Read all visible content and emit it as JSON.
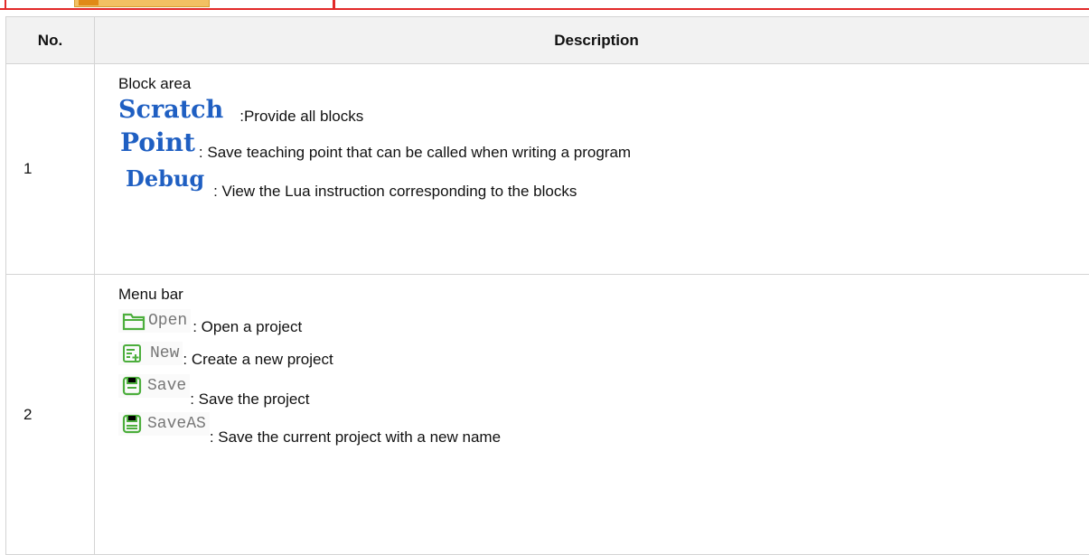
{
  "table": {
    "headers": [
      "No.",
      "Description"
    ],
    "rows": [
      {
        "no": "1",
        "title": "Block area",
        "items": [
          {
            "icon": "Scratch",
            "sep": ":",
            "text": "Provide all blocks"
          },
          {
            "icon": "Point",
            "sep": ": ",
            "text": "Save teaching point that can be called when writing a program"
          },
          {
            "icon": "Debug",
            "sep": ": ",
            "text": "View the Lua instruction corresponding to the blocks"
          }
        ]
      },
      {
        "no": "2",
        "title": "Menu bar",
        "items": [
          {
            "icon": "Open",
            "icon_name": "folder-icon",
            "sep": ": ",
            "text": "Open a project"
          },
          {
            "icon": "New",
            "icon_name": "new-file-icon",
            "sep": ": ",
            "text": "Create a new project"
          },
          {
            "icon": "Save",
            "icon_name": "save-icon",
            "sep": ": ",
            "text": "Save the project"
          },
          {
            "icon": "SaveAS",
            "icon_name": "save-as-icon",
            "sep": ": ",
            "text": "Save the current project with a new name"
          }
        ]
      }
    ]
  },
  "colors": {
    "block_icon": "#1f5fc2",
    "menu_icon": "#4cae3c",
    "frame": "#e22a2a"
  }
}
